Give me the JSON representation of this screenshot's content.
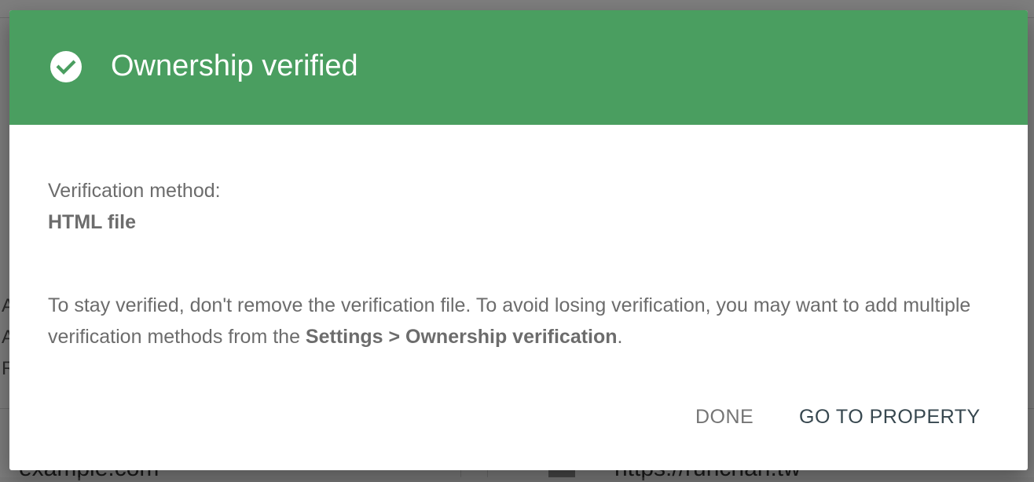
{
  "background": {
    "side_letters": [
      "A",
      "A",
      "R"
    ],
    "left_field_text": "example.com",
    "right_field_text": "https://runchan.tw"
  },
  "dialog": {
    "title": "Ownership verified",
    "header_icon": "check-circle-icon",
    "header_color": "#4a9e60",
    "method_label": "Verification method:",
    "method_value": "HTML file",
    "info_text_part1": "To stay verified, don't remove the verification file. To avoid losing verification, you may want to add multiple verification methods from the ",
    "info_text_bold": "Settings > Ownership verification",
    "info_text_part2": ".",
    "buttons": {
      "done": "DONE",
      "go_to_property": "GO TO PROPERTY"
    }
  }
}
